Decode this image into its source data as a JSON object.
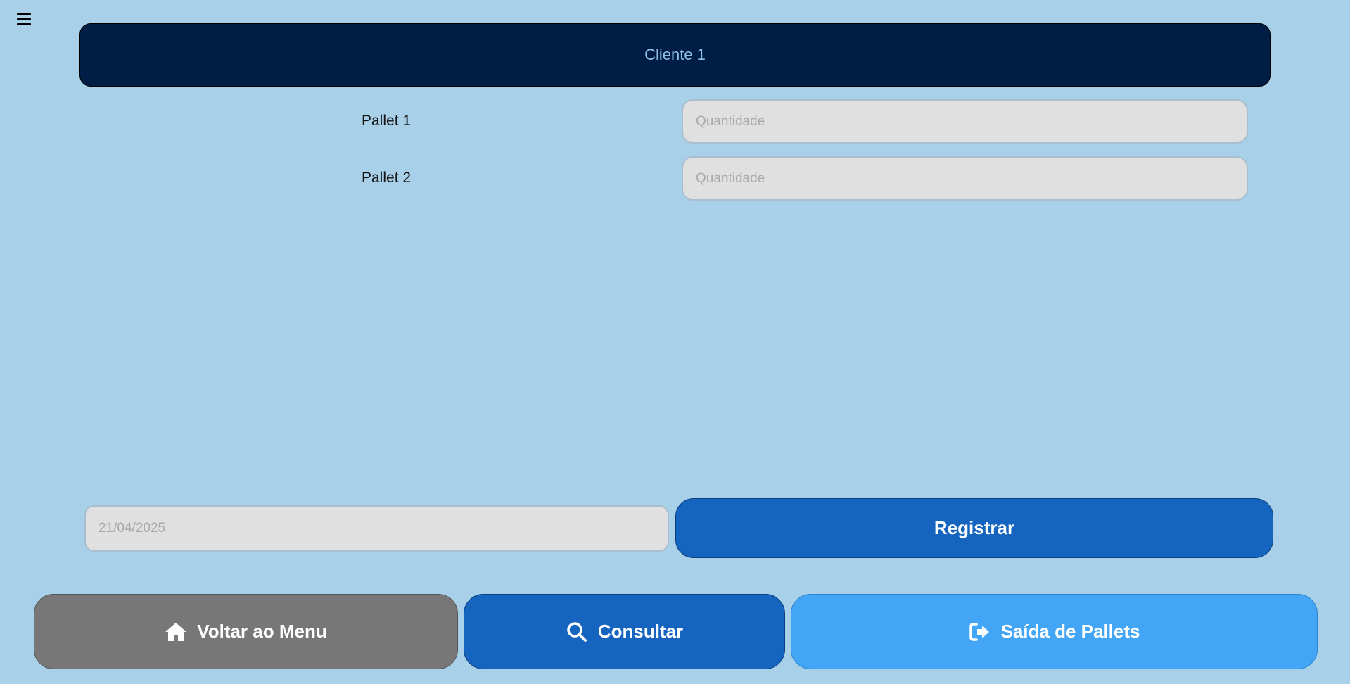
{
  "menu_toggle": {
    "icon": "hamburger-menu-icon"
  },
  "header": {
    "client_name": "Cliente 1"
  },
  "pallets": [
    {
      "label": "Pallet 1",
      "placeholder": "Quantidade",
      "value": ""
    },
    {
      "label": "Pallet 2",
      "placeholder": "Quantidade",
      "value": ""
    }
  ],
  "date_field": {
    "placeholder": "21/04/2025",
    "value": ""
  },
  "register_button": {
    "label": "Registrar"
  },
  "nav": {
    "menu_label": "Voltar ao Menu",
    "consult_label": "Consultar",
    "exit_label": "Saída de Pallets"
  },
  "colors": {
    "background": "#a8d0e8",
    "header": "#001e45",
    "primary": "#1565c0",
    "secondary": "#777777",
    "accent": "#42a5f5"
  }
}
